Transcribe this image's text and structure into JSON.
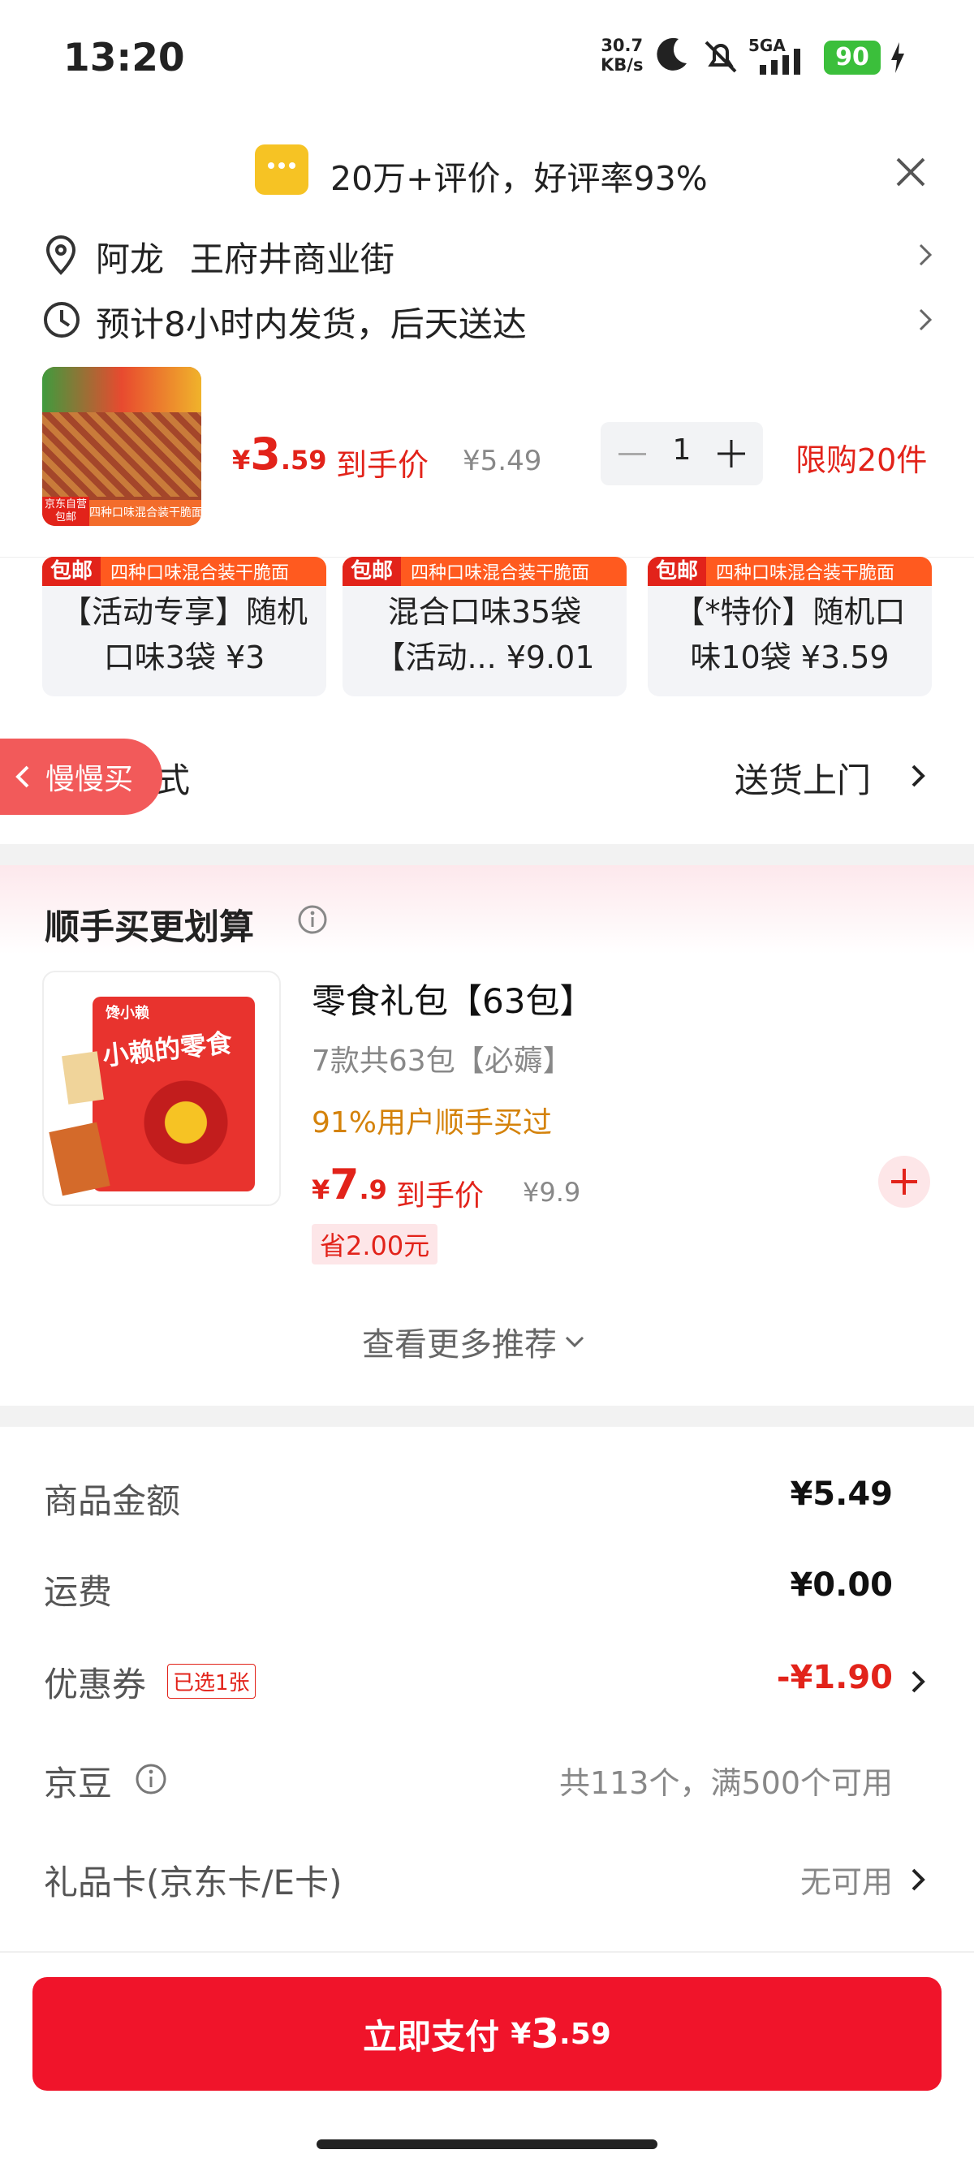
{
  "status_bar": {
    "time": "13:20",
    "net_speed": "30.7",
    "net_unit": "KB/s",
    "signal": "5GA",
    "battery": "90"
  },
  "banner": {
    "rating_text": "20万+评价，好评率93%"
  },
  "address": {
    "name": "阿龙",
    "street": "王府井商业街",
    "shipping": "预计8小时内发货，后天送达"
  },
  "product": {
    "currency": "¥",
    "price_int": "3",
    "price_dec": ".59",
    "price_label": "到手价",
    "original_price": "¥5.49",
    "quantity": "1",
    "limit": "限购20件",
    "thumb_tag": "京东自营",
    "thumb_free": "包邮",
    "thumb_caption": "四种口味混合装干脆面"
  },
  "variants": [
    {
      "tag": "包邮",
      "tag_text": "四种口味混合装干脆面",
      "line1": "【活动专享】随机",
      "line2": "口味3袋 ¥3"
    },
    {
      "tag": "包邮",
      "tag_text": "四种口味混合装干脆面",
      "line1": "混合口味35袋",
      "line2": "【活动... ¥9.01"
    },
    {
      "tag": "包邮",
      "tag_text": "四种口味混合装干脆面",
      "line1": "【*特价】随机口",
      "line2": "味10袋 ¥3.59"
    }
  ],
  "delivery": {
    "slow_buy": "慢慢买",
    "label_tail": "方式",
    "value": "送货上门"
  },
  "recommend": {
    "title": "顺手买更划算",
    "item_title": "零食礼包【63包】",
    "item_sub": "7款共63包【必薅】",
    "item_stat": "91%用户顺手买过",
    "price_currency": "¥",
    "price_int": "7",
    "price_dec": ".9",
    "price_label": "到手价",
    "original_price": "¥9.9",
    "save": "省2.00元",
    "more": "查看更多推荐",
    "brand_text": "小赖的零食",
    "brand_logo": "馋小赖"
  },
  "summary": {
    "goods_label": "商品金额",
    "goods_value": "¥5.49",
    "shipping_label": "运费",
    "shipping_value": "¥0.00",
    "coupon_label": "优惠券",
    "coupon_tag": "已选1张",
    "coupon_value": "-¥1.90",
    "beans_label": "京豆",
    "beans_value": "共113个，满500个可用",
    "giftcard_label": "礼品卡(京东卡/E卡)",
    "giftcard_value": "无可用"
  },
  "pay": {
    "label": "立即支付",
    "currency": "¥",
    "price_int": "3",
    "price_dec": ".59"
  },
  "colors": {
    "accent_red": "#e2231a",
    "pay_button": "#f0142a",
    "orange_text": "#d4820a",
    "battery_green": "#3bbf3b"
  }
}
